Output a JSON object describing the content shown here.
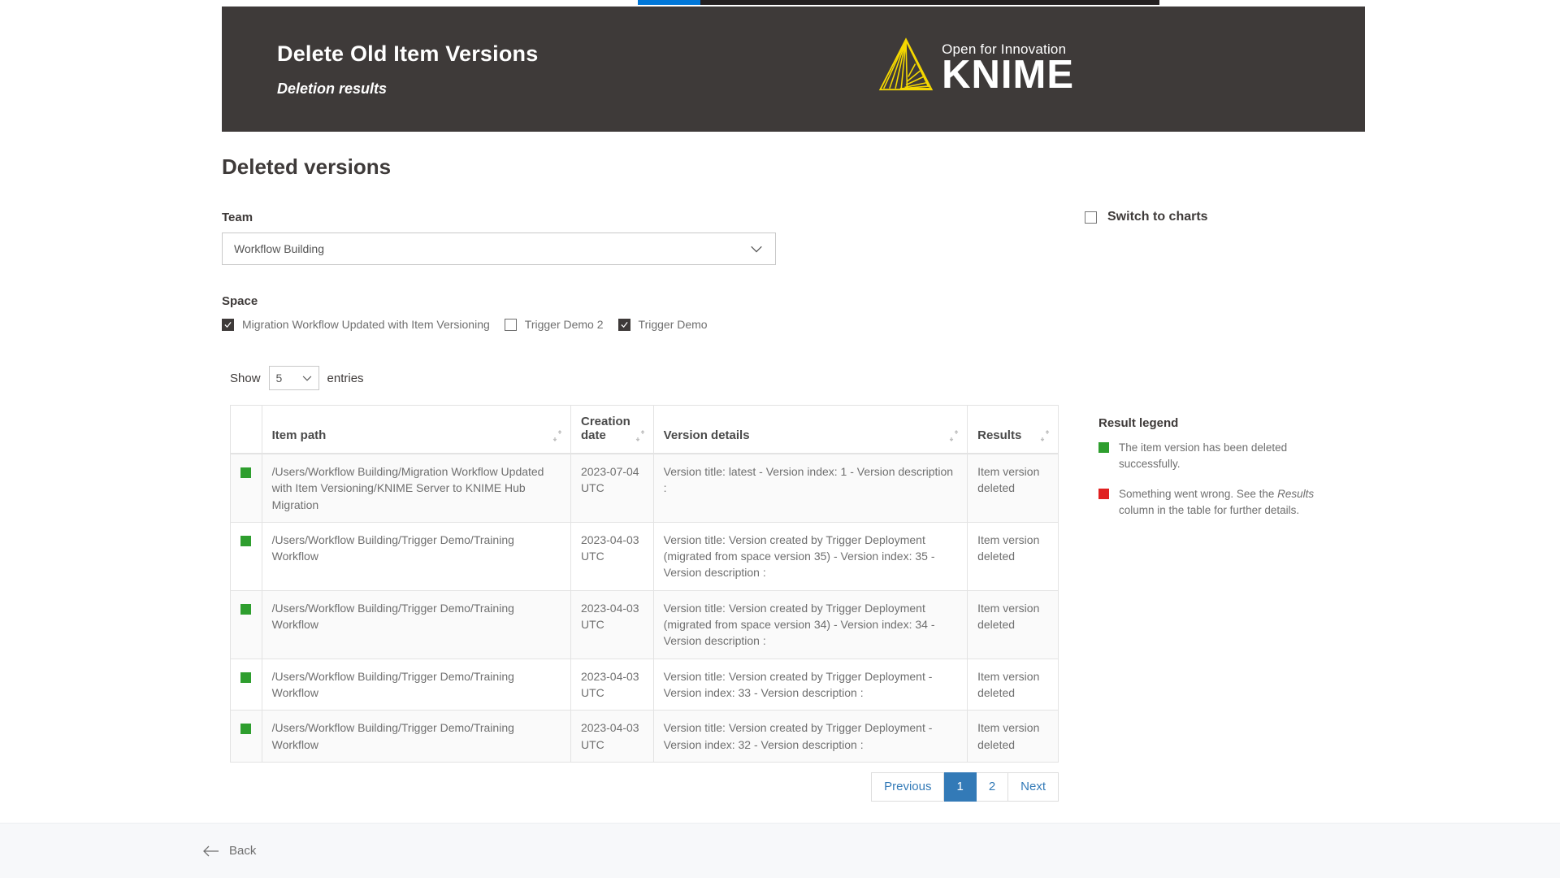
{
  "progress": {
    "percent": 12,
    "fill_color": "#0077d9",
    "track_color": "#231f20"
  },
  "banner": {
    "title": "Delete Old Item Versions",
    "subtitle": "Deletion results",
    "background_color": "#3e3a39",
    "logo": {
      "mark": "knime-triangle-icon",
      "tagline": "Open for Innovation",
      "name": "KNIME",
      "color": "#f5d800"
    }
  },
  "main": {
    "section_title": "Deleted versions",
    "team": {
      "label": "Team",
      "selected": "Workflow Building",
      "caret_icon": "chevron-down-icon"
    },
    "space": {
      "label": "Space",
      "options": [
        {
          "label": "Migration Workflow Updated with Item Versioning",
          "checked": true
        },
        {
          "label": "Trigger Demo 2",
          "checked": false
        },
        {
          "label": "Trigger Demo",
          "checked": true
        }
      ]
    },
    "switch_to_charts": {
      "label": "Switch to charts",
      "checked": false
    }
  },
  "table": {
    "show_label": "Show",
    "entries_value": "5",
    "entries_label": "entries",
    "columns": [
      {
        "label": "",
        "sortable": false
      },
      {
        "label": "Item path",
        "sortable": true
      },
      {
        "label": "Creation date",
        "sortable": true
      },
      {
        "label": "Version details",
        "sortable": true
      },
      {
        "label": "Results",
        "sortable": true
      }
    ],
    "rows": [
      {
        "status_color": "#2e9e2e",
        "item_path": "/Users/Workflow Building/Migration Workflow Updated with Item Versioning/KNIME Server to KNIME Hub Migration",
        "creation_date": "2023-07-04 UTC",
        "version_details": "Version title: latest - Version index: 1 - Version description :",
        "results": "Item version deleted"
      },
      {
        "status_color": "#2e9e2e",
        "item_path": "/Users/Workflow Building/Trigger Demo/Training Workflow",
        "creation_date": "2023-04-03 UTC",
        "version_details": "Version title: Version created by Trigger Deployment (migrated from space version 35) - Version index: 35 - Version description :",
        "results": "Item version deleted"
      },
      {
        "status_color": "#2e9e2e",
        "item_path": "/Users/Workflow Building/Trigger Demo/Training Workflow",
        "creation_date": "2023-04-03 UTC",
        "version_details": "Version title: Version created by Trigger Deployment (migrated from space version 34) - Version index: 34 - Version description :",
        "results": "Item version deleted"
      },
      {
        "status_color": "#2e9e2e",
        "item_path": "/Users/Workflow Building/Trigger Demo/Training Workflow",
        "creation_date": "2023-04-03 UTC",
        "version_details": "Version title: Version created by Trigger Deployment - Version index: 33 - Version description :",
        "results": "Item version deleted"
      },
      {
        "status_color": "#2e9e2e",
        "item_path": "/Users/Workflow Building/Trigger Demo/Training Workflow",
        "creation_date": "2023-04-03 UTC",
        "version_details": "Version title: Version created by Trigger Deployment - Version index: 32 - Version description :",
        "results": "Item version deleted"
      }
    ],
    "pagination": {
      "previous": "Previous",
      "pages": [
        "1",
        "2"
      ],
      "active_page": "1",
      "next": "Next",
      "active_color": "#337ab7"
    }
  },
  "legend": {
    "title": "Result legend",
    "items": [
      {
        "color": "#2e9e2e",
        "text_before": "The item version has been deleted successfully.",
        "emphasis": "",
        "text_after": ""
      },
      {
        "color": "#e02020",
        "text_before": "Something went wrong. See the ",
        "emphasis": "Results",
        "text_after": " column in the table for further details."
      }
    ]
  },
  "footer": {
    "back_label": "Back",
    "back_icon": "arrow-left-icon"
  }
}
